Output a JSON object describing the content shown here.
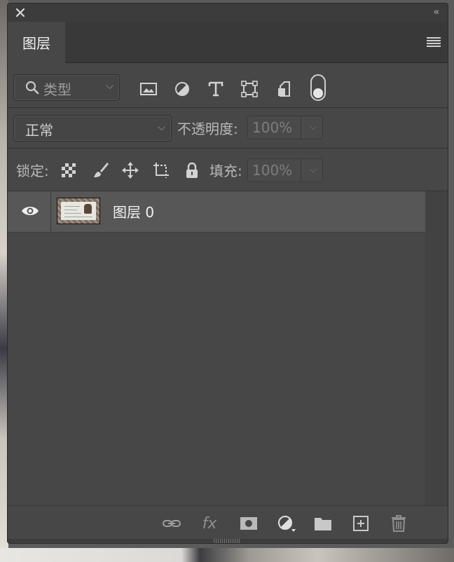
{
  "panel": {
    "title_tab": "图层",
    "filter": {
      "kind_label": "类型",
      "icons": [
        "image-filter-icon",
        "adjustment-filter-icon",
        "type-filter-icon",
        "shape-filter-icon",
        "smart-object-filter-icon"
      ],
      "toggle_on": true
    },
    "blend": {
      "mode": "正常",
      "opacity_label": "不透明度:",
      "opacity_value": "100%"
    },
    "lock": {
      "label": "锁定:",
      "fill_label": "填充:",
      "fill_value": "100%"
    },
    "layers": [
      {
        "name": "图层 0",
        "visible": true
      }
    ],
    "bottom_icons": [
      "link-layers-icon",
      "fx-icon",
      "layer-mask-icon",
      "adjustment-layer-icon",
      "new-group-icon",
      "new-layer-icon",
      "delete-icon"
    ],
    "fx_text": "fx"
  }
}
